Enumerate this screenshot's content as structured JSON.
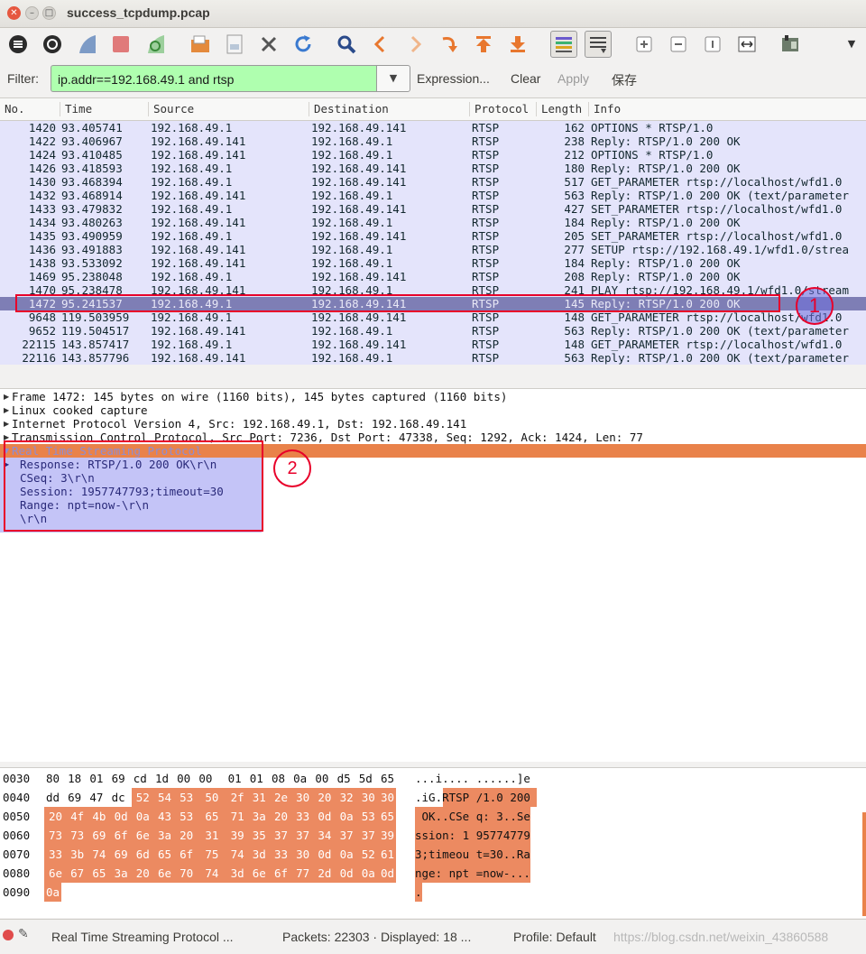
{
  "window": {
    "title": "success_tcpdump.pcap",
    "close": "✕",
    "minimize": "–",
    "maximize": "□"
  },
  "filter": {
    "label": "Filter:",
    "value": "ip.addr==192.168.49.1 and rtsp",
    "expression": "Expression...",
    "clear": "Clear",
    "apply": "Apply",
    "save": "保存"
  },
  "columns": [
    "No.",
    "Time",
    "Source",
    "Destination",
    "Protocol",
    "Length",
    "Info"
  ],
  "packets": [
    {
      "no": "1420",
      "time": "93.405741",
      "src": "192.168.49.1",
      "dst": "192.168.49.141",
      "proto": "RTSP",
      "len": "162",
      "info": "OPTIONS * RTSP/1.0"
    },
    {
      "no": "1422",
      "time": "93.406967",
      "src": "192.168.49.141",
      "dst": "192.168.49.1",
      "proto": "RTSP",
      "len": "238",
      "info": "Reply: RTSP/1.0 200 OK"
    },
    {
      "no": "1424",
      "time": "93.410485",
      "src": "192.168.49.141",
      "dst": "192.168.49.1",
      "proto": "RTSP",
      "len": "212",
      "info": "OPTIONS * RTSP/1.0"
    },
    {
      "no": "1426",
      "time": "93.418593",
      "src": "192.168.49.1",
      "dst": "192.168.49.141",
      "proto": "RTSP",
      "len": "180",
      "info": "Reply: RTSP/1.0 200 OK"
    },
    {
      "no": "1430",
      "time": "93.468394",
      "src": "192.168.49.1",
      "dst": "192.168.49.141",
      "proto": "RTSP",
      "len": "517",
      "info": "GET_PARAMETER rtsp://localhost/wfd1.0"
    },
    {
      "no": "1432",
      "time": "93.468914",
      "src": "192.168.49.141",
      "dst": "192.168.49.1",
      "proto": "RTSP",
      "len": "563",
      "info": "Reply: RTSP/1.0 200 OK (text/parameter"
    },
    {
      "no": "1433",
      "time": "93.479832",
      "src": "192.168.49.1",
      "dst": "192.168.49.141",
      "proto": "RTSP",
      "len": "427",
      "info": "SET_PARAMETER rtsp://localhost/wfd1.0"
    },
    {
      "no": "1434",
      "time": "93.480263",
      "src": "192.168.49.141",
      "dst": "192.168.49.1",
      "proto": "RTSP",
      "len": "184",
      "info": "Reply: RTSP/1.0 200 OK"
    },
    {
      "no": "1435",
      "time": "93.490959",
      "src": "192.168.49.1",
      "dst": "192.168.49.141",
      "proto": "RTSP",
      "len": "205",
      "info": "SET_PARAMETER rtsp://localhost/wfd1.0"
    },
    {
      "no": "1436",
      "time": "93.491883",
      "src": "192.168.49.141",
      "dst": "192.168.49.1",
      "proto": "RTSP",
      "len": "277",
      "info": "SETUP rtsp://192.168.49.1/wfd1.0/strea"
    },
    {
      "no": "1438",
      "time": "93.533092",
      "src": "192.168.49.141",
      "dst": "192.168.49.1",
      "proto": "RTSP",
      "len": "184",
      "info": "Reply: RTSP/1.0 200 OK"
    },
    {
      "no": "1469",
      "time": "95.238048",
      "src": "192.168.49.1",
      "dst": "192.168.49.141",
      "proto": "RTSP",
      "len": "208",
      "info": "Reply: RTSP/1.0 200 OK"
    },
    {
      "no": "1470",
      "time": "95.238478",
      "src": "192.168.49.141",
      "dst": "192.168.49.1",
      "proto": "RTSP",
      "len": "241",
      "info": "PLAY rtsp://192.168.49.1/wfd1.0/stream"
    },
    {
      "no": "1472",
      "time": "95.241537",
      "src": "192.168.49.1",
      "dst": "192.168.49.141",
      "proto": "RTSP",
      "len": "145",
      "info": "Reply: RTSP/1.0 200 OK"
    },
    {
      "no": "9648",
      "time": "119.503959",
      "src": "192.168.49.1",
      "dst": "192.168.49.141",
      "proto": "RTSP",
      "len": "148",
      "info": "GET_PARAMETER rtsp://localhost/wfd1.0"
    },
    {
      "no": "9652",
      "time": "119.504517",
      "src": "192.168.49.141",
      "dst": "192.168.49.1",
      "proto": "RTSP",
      "len": "563",
      "info": "Reply: RTSP/1.0 200 OK (text/parameter"
    },
    {
      "no": "22115",
      "time": "143.857417",
      "src": "192.168.49.1",
      "dst": "192.168.49.141",
      "proto": "RTSP",
      "len": "148",
      "info": "GET_PARAMETER rtsp://localhost/wfd1.0"
    },
    {
      "no": "22116",
      "time": "143.857796",
      "src": "192.168.49.141",
      "dst": "192.168.49.1",
      "proto": "RTSP",
      "len": "563",
      "info": "Reply: RTSP/1.0 200 OK (text/parameter"
    }
  ],
  "annotations": {
    "one": "1",
    "two": "2"
  },
  "details": {
    "tree": [
      "Frame 1472: 145 bytes on wire (1160 bits), 145 bytes captured (1160 bits)",
      "Linux cooked capture",
      "Internet Protocol Version 4, Src: 192.168.49.1, Dst: 192.168.49.141",
      "Transmission Control Protocol, Src Port: 7236, Dst Port: 47338, Seq: 1292, Ack: 1424, Len: 77",
      "Real Time Streaming Protocol"
    ],
    "rtsp": [
      "Response: RTSP/1.0 200 OK\\r\\n",
      "CSeq: 3\\r\\n",
      "Session: 1957747793;timeout=30",
      "Range: npt=now-\\r\\n",
      "\\r\\n"
    ]
  },
  "hex": [
    {
      "off": "0030",
      "bytes": [
        "80",
        "18",
        "01",
        "69",
        "cd",
        "1d",
        "00",
        "00",
        "01",
        "01",
        "08",
        "0a",
        "00",
        "d5",
        "5d",
        "65"
      ],
      "ascii": "...i.... ......]e"
    },
    {
      "off": "0040",
      "bytes": [
        "dd",
        "69",
        "47",
        "dc",
        "52",
        "54",
        "53",
        "50",
        "2f",
        "31",
        "2e",
        "30",
        "20",
        "32",
        "30",
        "30"
      ],
      "ascii": ".iG.RTSP /1.0 200"
    },
    {
      "off": "0050",
      "bytes": [
        "20",
        "4f",
        "4b",
        "0d",
        "0a",
        "43",
        "53",
        "65",
        "71",
        "3a",
        "20",
        "33",
        "0d",
        "0a",
        "53",
        "65"
      ],
      "ascii": " OK..CSe q: 3..Se"
    },
    {
      "off": "0060",
      "bytes": [
        "73",
        "73",
        "69",
        "6f",
        "6e",
        "3a",
        "20",
        "31",
        "39",
        "35",
        "37",
        "37",
        "34",
        "37",
        "37",
        "39"
      ],
      "ascii": "ssion: 1 95774779"
    },
    {
      "off": "0070",
      "bytes": [
        "33",
        "3b",
        "74",
        "69",
        "6d",
        "65",
        "6f",
        "75",
        "74",
        "3d",
        "33",
        "30",
        "0d",
        "0a",
        "52",
        "61"
      ],
      "ascii": "3;timeou t=30..Ra"
    },
    {
      "off": "0080",
      "bytes": [
        "6e",
        "67",
        "65",
        "3a",
        "20",
        "6e",
        "70",
        "74",
        "3d",
        "6e",
        "6f",
        "77",
        "2d",
        "0d",
        "0a",
        "0d"
      ],
      "ascii": "nge: npt =now-..."
    },
    {
      "off": "0090",
      "bytes": [
        "0a"
      ],
      "ascii": "."
    }
  ],
  "status": {
    "proto": "Real Time Streaming Protocol ...",
    "packets": "Packets: 22303 · Displayed: 18 ...",
    "profile": "Profile: Default",
    "watermark": "https://blog.csdn.net/weixin_43860588"
  },
  "toolbar_icons": [
    "list-interfaces-icon",
    "options-icon",
    "start-capture-icon",
    "stop-capture-icon",
    "restart-capture-icon",
    "open-file-icon",
    "save-file-icon",
    "close-file-icon",
    "reload-icon",
    "find-icon",
    "back-icon",
    "forward-icon",
    "goto-packet-icon",
    "first-packet-icon",
    "last-packet-icon",
    "colorize-icon",
    "autoscroll-icon",
    "zoom-in-icon",
    "zoom-out-icon",
    "normal-size-icon",
    "resize-columns-icon",
    "preferences-icon",
    "more-icon"
  ],
  "colors": {
    "accent": "#e9824a",
    "selected_row": "#7e7eb5",
    "row_bg": "#e4e4fb",
    "filter_ok": "#afffaf",
    "annotation": "#e8002a"
  }
}
